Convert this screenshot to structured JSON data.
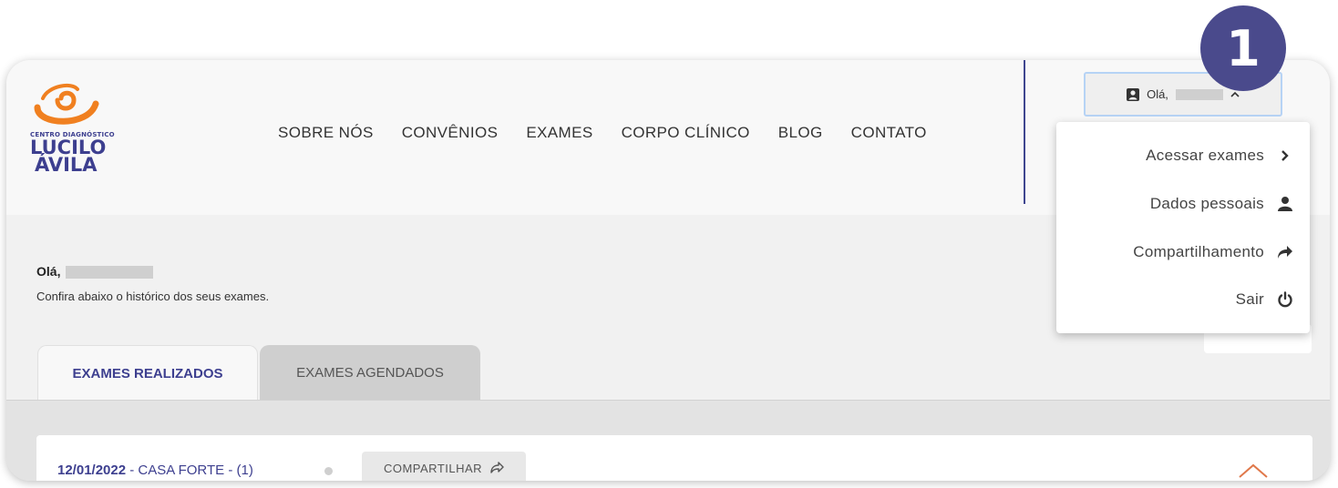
{
  "logo": {
    "small_text": "CENTRO DIAGNÓSTICO",
    "line1": "LUCILO",
    "line2": "ÁVILA",
    "accent_color": "#f08020",
    "brand_color": "#3d3f8f"
  },
  "nav": [
    "SOBRE NÓS",
    "CONVÊNIOS",
    "EXAMES",
    "CORPO CLÍNICO",
    "BLOG",
    "CONTATO"
  ],
  "user_button": {
    "greeting": "Olá,",
    "icon": "user-icon",
    "caret": "chevron-up-icon"
  },
  "dropdown": [
    {
      "label": "Acessar exames",
      "icon": "chevron-right-icon"
    },
    {
      "label": "Dados pessoais",
      "icon": "user-icon"
    },
    {
      "label": "Compartilhamento",
      "icon": "share-arrow-icon"
    },
    {
      "label": "Sair",
      "icon": "power-icon"
    }
  ],
  "greeting": {
    "title": "Olá,",
    "subtitle": "Confira abaixo o histórico dos seus exames."
  },
  "tabs": {
    "active": "EXAMES REALIZADOS",
    "inactive": "EXAMES AGENDADOS"
  },
  "exam": {
    "date": "12/01/2022",
    "location": " - CASA FORTE - (1)",
    "share_label": "COMPARTILHAR"
  },
  "badge": "1"
}
